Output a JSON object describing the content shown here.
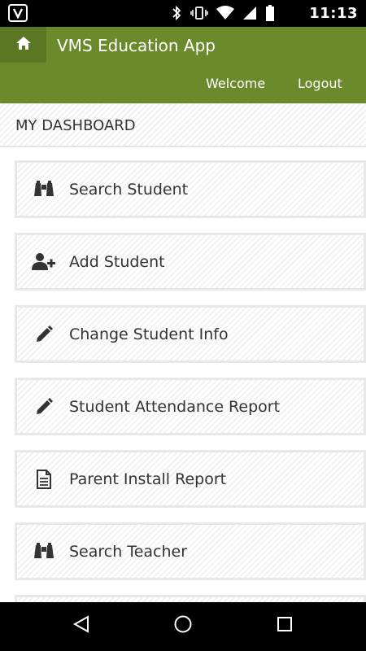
{
  "status_bar": {
    "time": "11:13",
    "icons": [
      "app-v-icon",
      "bluetooth-icon",
      "vibrate-icon",
      "wifi-icon",
      "signal-icon",
      "battery-icon"
    ]
  },
  "header": {
    "title": "VMS Education App",
    "home_icon": "home-icon",
    "nav": {
      "welcome": "Welcome",
      "logout": "Logout"
    },
    "color": "#6b8a2c"
  },
  "dashboard": {
    "title": "MY DASHBOARD",
    "items": [
      {
        "label": "Search Student",
        "icon": "binoculars-icon"
      },
      {
        "label": "Add Student",
        "icon": "add-user-icon"
      },
      {
        "label": "Change Student Info",
        "icon": "pencil-icon"
      },
      {
        "label": "Student Attendance Report",
        "icon": "pencil-icon"
      },
      {
        "label": "Parent Install Report",
        "icon": "document-icon"
      },
      {
        "label": "Search Teacher",
        "icon": "binoculars-icon"
      }
    ]
  },
  "nav_bar": {
    "buttons": [
      "back-icon",
      "home-circle-icon",
      "recents-icon"
    ]
  }
}
